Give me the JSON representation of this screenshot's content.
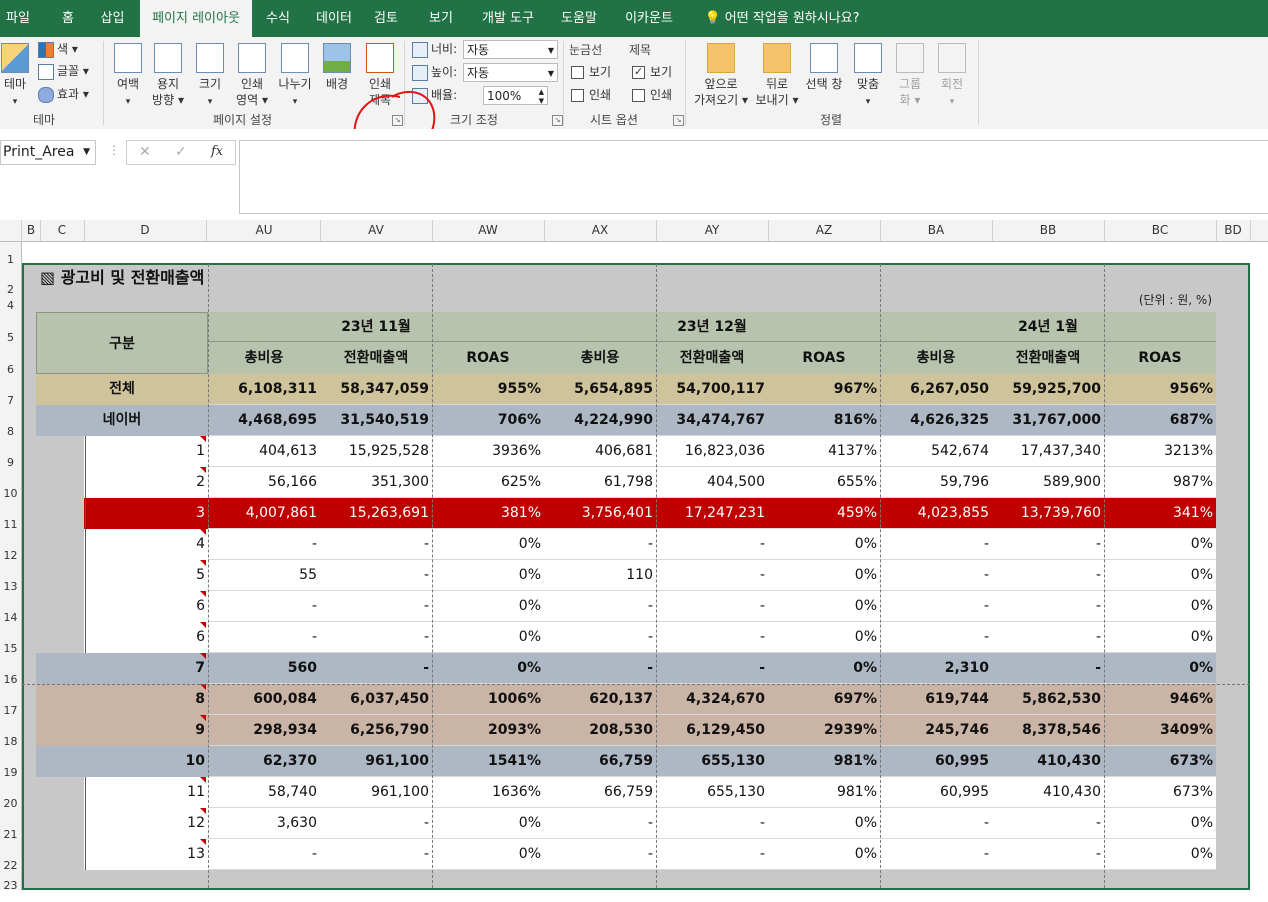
{
  "ribbon_tabs": [
    "파일",
    "홈",
    "삽입",
    "페이지 레이아웃",
    "수식",
    "데이터",
    "검토",
    "보기",
    "개발 도구",
    "도움말",
    "이카운트",
    "어떤 작업을 원하시나요?"
  ],
  "ribbon": {
    "theme": {
      "big": "테마",
      "colors": "색",
      "fonts": "글꼴",
      "effects": "효과",
      "group": "테마"
    },
    "page_setup": {
      "margins": "여백",
      "orientation": "용지\n방향",
      "size": "크기",
      "print_area": "인쇄\n영역",
      "breaks": "나누기",
      "background": "배경",
      "print_titles": "인쇄\n제목",
      "group": "페이지 설정"
    },
    "scale": {
      "width_label": "너비:",
      "width_val": "자동",
      "height_label": "높이:",
      "height_val": "자동",
      "scale_label": "배율:",
      "scale_val": "100%",
      "group": "크기 조정"
    },
    "sheet_options": {
      "gridlines": "눈금선",
      "headings": "제목",
      "view": "보기",
      "print": "인쇄",
      "group": "시트 옵션"
    },
    "arrange": {
      "forward": "앞으로\n가져오기",
      "backward": "뒤로\n보내기",
      "selection": "선택 창",
      "align": "맞춤",
      "group_btn": "그룹\n화",
      "rotate": "회전",
      "group": "정렬"
    }
  },
  "name_box": "Print_Area",
  "fx_label": "fx",
  "columns": [
    "B",
    "C",
    "D",
    "AU",
    "AV",
    "AW",
    "AX",
    "AY",
    "AZ",
    "BA",
    "BB",
    "BC",
    "BD"
  ],
  "rows": [
    "1",
    "2",
    "4",
    "5",
    "6",
    "7",
    "8",
    "9",
    "10",
    "11",
    "12",
    "13",
    "14",
    "15",
    "16",
    "17",
    "18",
    "19",
    "20",
    "21",
    "22",
    "23"
  ],
  "sheet": {
    "title": "광고비 및 전환매출액",
    "unit": "(단위 : 원, %)",
    "category_header": "구분",
    "months": [
      "23년 11월",
      "23년 12월",
      "24년 1월"
    ],
    "subheaders": [
      "총비용",
      "전환매출액",
      "ROAS"
    ],
    "table": [
      {
        "label": "전체",
        "style": "total",
        "vals": [
          "6,108,311",
          "58,347,059",
          "955%",
          "5,654,895",
          "54,700,117",
          "967%",
          "6,267,050",
          "59,925,700",
          "956%"
        ]
      },
      {
        "label": "네이버",
        "style": "naver",
        "vals": [
          "4,468,695",
          "31,540,519",
          "706%",
          "4,224,990",
          "34,474,767",
          "816%",
          "4,626,325",
          "31,767,000",
          "687%"
        ]
      },
      {
        "label": "1",
        "style": "plain",
        "vals": [
          "404,613",
          "15,925,528",
          "3936%",
          "406,681",
          "16,823,036",
          "4137%",
          "542,674",
          "17,437,340",
          "3213%"
        ]
      },
      {
        "label": "2",
        "style": "plain",
        "vals": [
          "56,166",
          "351,300",
          "625%",
          "61,798",
          "404,500",
          "655%",
          "59,796",
          "589,900",
          "987%"
        ]
      },
      {
        "label": "3",
        "style": "red",
        "vals": [
          "4,007,861",
          "15,263,691",
          "381%",
          "3,756,401",
          "17,247,231",
          "459%",
          "4,023,855",
          "13,739,760",
          "341%"
        ]
      },
      {
        "label": "4",
        "style": "plain",
        "vals": [
          "-",
          "-",
          "0%",
          "-",
          "-",
          "0%",
          "-",
          "-",
          "0%"
        ]
      },
      {
        "label": "5",
        "style": "plain",
        "vals": [
          "55",
          "-",
          "0%",
          "110",
          "-",
          "0%",
          "-",
          "-",
          "0%"
        ]
      },
      {
        "label": "6",
        "style": "plain",
        "vals": [
          "-",
          "-",
          "0%",
          "-",
          "-",
          "0%",
          "-",
          "-",
          "0%"
        ]
      },
      {
        "label": "6",
        "style": "plain",
        "vals": [
          "-",
          "-",
          "0%",
          "-",
          "-",
          "0%",
          "-",
          "-",
          "0%"
        ]
      },
      {
        "label": "7",
        "style": "blue",
        "vals": [
          "560",
          "-",
          "0%",
          "-",
          "-",
          "0%",
          "2,310",
          "-",
          "0%"
        ]
      },
      {
        "label": "8",
        "style": "tan",
        "vals": [
          "600,084",
          "6,037,450",
          "1006%",
          "620,137",
          "4,324,670",
          "697%",
          "619,744",
          "5,862,530",
          "946%"
        ]
      },
      {
        "label": "9",
        "style": "tan",
        "vals": [
          "298,934",
          "6,256,790",
          "2093%",
          "208,530",
          "6,129,450",
          "2939%",
          "245,746",
          "8,378,546",
          "3409%"
        ]
      },
      {
        "label": "10",
        "style": "blue",
        "vals": [
          "62,370",
          "961,100",
          "1541%",
          "66,759",
          "655,130",
          "981%",
          "60,995",
          "410,430",
          "673%"
        ]
      },
      {
        "label": "11",
        "style": "plain",
        "vals": [
          "58,740",
          "961,100",
          "1636%",
          "66,759",
          "655,130",
          "981%",
          "60,995",
          "410,430",
          "673%"
        ]
      },
      {
        "label": "12",
        "style": "plain",
        "vals": [
          "3,630",
          "-",
          "0%",
          "-",
          "-",
          "0%",
          "-",
          "-",
          "0%"
        ]
      },
      {
        "label": "13",
        "style": "plain",
        "vals": [
          "-",
          "-",
          "0%",
          "-",
          "-",
          "0%",
          "-",
          "-",
          "0%"
        ]
      }
    ]
  },
  "colors": {
    "accent": "#217346",
    "header_green": "#b7c3ad",
    "total_tan": "#cfc39c",
    "naver_blue": "#aeb8c4",
    "red_row": "#c00000",
    "tan_row": "#c9b4a5",
    "sheet_gray": "#c8c8c8"
  }
}
